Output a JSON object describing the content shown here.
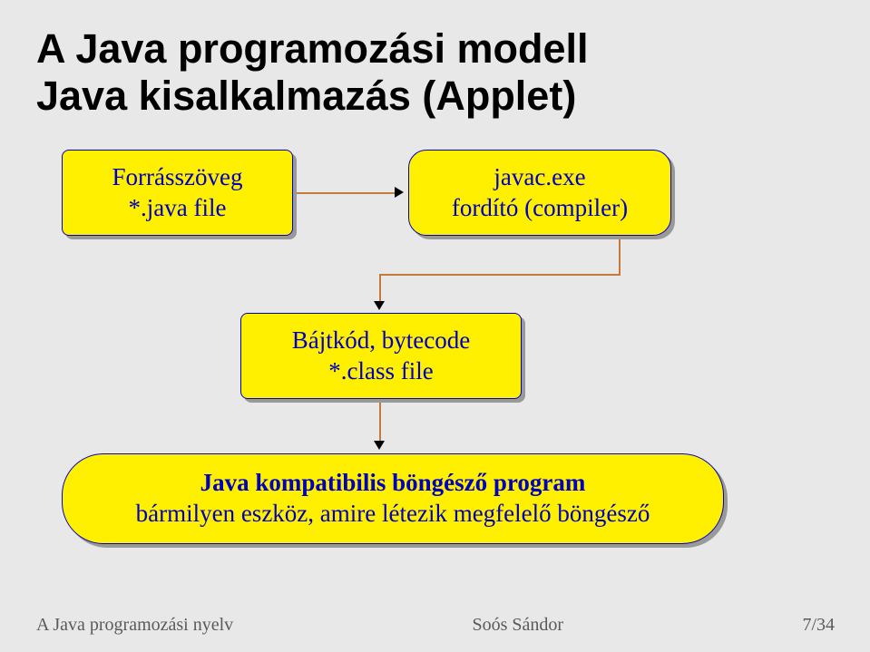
{
  "title_line1": "A Java programozási modell",
  "title_line2": "Java kisalkalmazás (Applet)",
  "boxes": {
    "source": {
      "line1": "Forrásszöveg",
      "line2": "*.java file"
    },
    "compiler": {
      "line1": "javac.exe",
      "line2": "fordító (compiler)"
    },
    "bytecode": {
      "line1": "Bájtkód, bytecode",
      "line2": "*.class file"
    },
    "browser": {
      "line1": "Java kompatibilis böngésző program",
      "line2": "bármilyen eszköz, amire létezik megfelelő böngésző"
    }
  },
  "footer": {
    "left": "A Java programozási nyelv",
    "center": "Soós Sándor",
    "right": "7/34"
  },
  "chart_data": {
    "type": "diagram",
    "title": "A Java programozási modell — Java kisalkalmazás (Applet)",
    "nodes": [
      {
        "id": "source",
        "label": "Forrásszöveg *.java file",
        "shape": "rounded-rect"
      },
      {
        "id": "compiler",
        "label": "javac.exe fordító (compiler)",
        "shape": "rounded-rect"
      },
      {
        "id": "bytecode",
        "label": "Bájtkód, bytecode *.class file",
        "shape": "rounded-rect"
      },
      {
        "id": "browser",
        "label": "Java kompatibilis böngésző program — bármilyen eszköz, amire létezik megfelelő böngésző",
        "shape": "pill"
      }
    ],
    "edges": [
      {
        "from": "source",
        "to": "compiler"
      },
      {
        "from": "compiler",
        "to": "bytecode"
      },
      {
        "from": "bytecode",
        "to": "browser"
      }
    ],
    "colors": {
      "node_fill": "#fff000",
      "node_border": "#0000c0",
      "node_text": "#0000c0",
      "edge": "#c47a3a"
    }
  }
}
